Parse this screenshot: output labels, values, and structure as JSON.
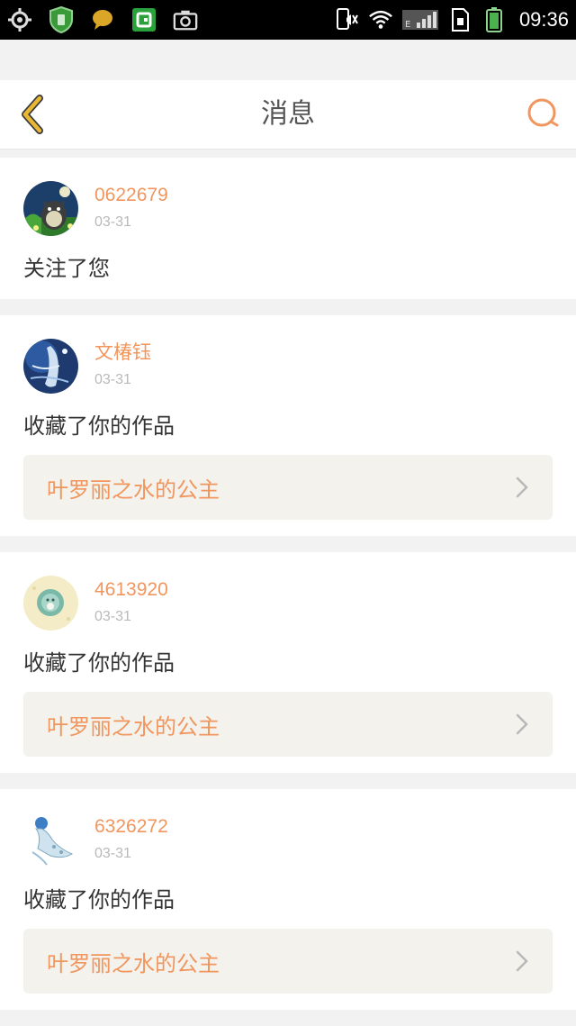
{
  "status_bar": {
    "time": "09:36",
    "network": "E",
    "icons": [
      "location-target-icon",
      "shield-icon",
      "chat-bubble-icon",
      "green-app-icon",
      "camera-icon",
      "mute-icon",
      "wifi-icon",
      "signal-icon",
      "sim-icon",
      "battery-icon"
    ]
  },
  "header": {
    "title": "消息"
  },
  "colors": {
    "accent": "#f0965e",
    "back_arrow": "#e8b835",
    "card_bg": "#ffffff",
    "page_bg": "#f2f2f2",
    "work_bg": "#f3f2ec"
  },
  "messages": [
    {
      "username": "0622679",
      "date": "03-31",
      "action": "关注了您"
    },
    {
      "username": "文椿钰",
      "date": "03-31",
      "action": "收藏了你的作品",
      "work_title": "叶罗丽之水的公主"
    },
    {
      "username": "4613920",
      "date": "03-31",
      "action": "收藏了你的作品",
      "work_title": "叶罗丽之水的公主"
    },
    {
      "username": "6326272",
      "date": "03-31",
      "action": "收藏了你的作品",
      "work_title": "叶罗丽之水的公主"
    }
  ]
}
